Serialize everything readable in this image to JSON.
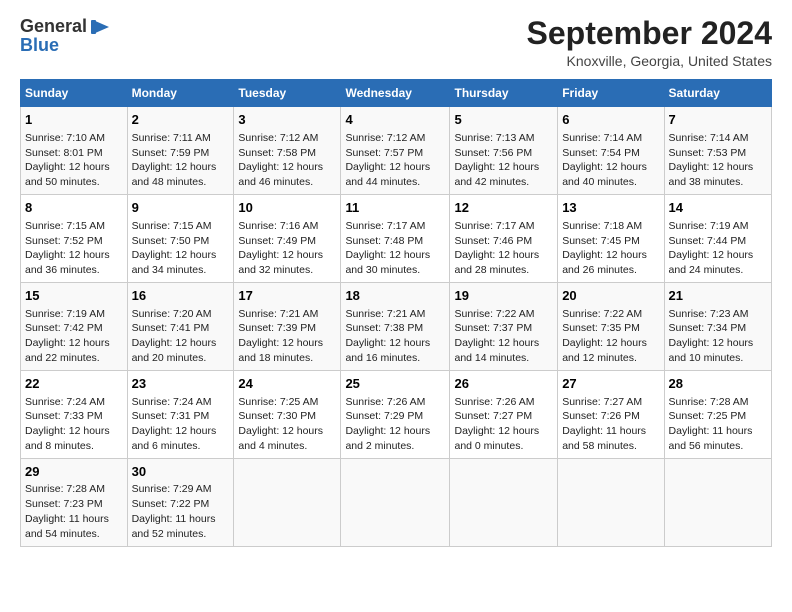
{
  "logo": {
    "general": "General",
    "blue": "Blue",
    "arrow": "▶"
  },
  "title": "September 2024",
  "subtitle": "Knoxville, Georgia, United States",
  "columns": [
    "Sunday",
    "Monday",
    "Tuesday",
    "Wednesday",
    "Thursday",
    "Friday",
    "Saturday"
  ],
  "weeks": [
    [
      {
        "day": "1",
        "lines": [
          "Sunrise: 7:10 AM",
          "Sunset: 8:01 PM",
          "Daylight: 12 hours",
          "and 50 minutes."
        ]
      },
      {
        "day": "2",
        "lines": [
          "Sunrise: 7:11 AM",
          "Sunset: 7:59 PM",
          "Daylight: 12 hours",
          "and 48 minutes."
        ]
      },
      {
        "day": "3",
        "lines": [
          "Sunrise: 7:12 AM",
          "Sunset: 7:58 PM",
          "Daylight: 12 hours",
          "and 46 minutes."
        ]
      },
      {
        "day": "4",
        "lines": [
          "Sunrise: 7:12 AM",
          "Sunset: 7:57 PM",
          "Daylight: 12 hours",
          "and 44 minutes."
        ]
      },
      {
        "day": "5",
        "lines": [
          "Sunrise: 7:13 AM",
          "Sunset: 7:56 PM",
          "Daylight: 12 hours",
          "and 42 minutes."
        ]
      },
      {
        "day": "6",
        "lines": [
          "Sunrise: 7:14 AM",
          "Sunset: 7:54 PM",
          "Daylight: 12 hours",
          "and 40 minutes."
        ]
      },
      {
        "day": "7",
        "lines": [
          "Sunrise: 7:14 AM",
          "Sunset: 7:53 PM",
          "Daylight: 12 hours",
          "and 38 minutes."
        ]
      }
    ],
    [
      {
        "day": "8",
        "lines": [
          "Sunrise: 7:15 AM",
          "Sunset: 7:52 PM",
          "Daylight: 12 hours",
          "and 36 minutes."
        ]
      },
      {
        "day": "9",
        "lines": [
          "Sunrise: 7:15 AM",
          "Sunset: 7:50 PM",
          "Daylight: 12 hours",
          "and 34 minutes."
        ]
      },
      {
        "day": "10",
        "lines": [
          "Sunrise: 7:16 AM",
          "Sunset: 7:49 PM",
          "Daylight: 12 hours",
          "and 32 minutes."
        ]
      },
      {
        "day": "11",
        "lines": [
          "Sunrise: 7:17 AM",
          "Sunset: 7:48 PM",
          "Daylight: 12 hours",
          "and 30 minutes."
        ]
      },
      {
        "day": "12",
        "lines": [
          "Sunrise: 7:17 AM",
          "Sunset: 7:46 PM",
          "Daylight: 12 hours",
          "and 28 minutes."
        ]
      },
      {
        "day": "13",
        "lines": [
          "Sunrise: 7:18 AM",
          "Sunset: 7:45 PM",
          "Daylight: 12 hours",
          "and 26 minutes."
        ]
      },
      {
        "day": "14",
        "lines": [
          "Sunrise: 7:19 AM",
          "Sunset: 7:44 PM",
          "Daylight: 12 hours",
          "and 24 minutes."
        ]
      }
    ],
    [
      {
        "day": "15",
        "lines": [
          "Sunrise: 7:19 AM",
          "Sunset: 7:42 PM",
          "Daylight: 12 hours",
          "and 22 minutes."
        ]
      },
      {
        "day": "16",
        "lines": [
          "Sunrise: 7:20 AM",
          "Sunset: 7:41 PM",
          "Daylight: 12 hours",
          "and 20 minutes."
        ]
      },
      {
        "day": "17",
        "lines": [
          "Sunrise: 7:21 AM",
          "Sunset: 7:39 PM",
          "Daylight: 12 hours",
          "and 18 minutes."
        ]
      },
      {
        "day": "18",
        "lines": [
          "Sunrise: 7:21 AM",
          "Sunset: 7:38 PM",
          "Daylight: 12 hours",
          "and 16 minutes."
        ]
      },
      {
        "day": "19",
        "lines": [
          "Sunrise: 7:22 AM",
          "Sunset: 7:37 PM",
          "Daylight: 12 hours",
          "and 14 minutes."
        ]
      },
      {
        "day": "20",
        "lines": [
          "Sunrise: 7:22 AM",
          "Sunset: 7:35 PM",
          "Daylight: 12 hours",
          "and 12 minutes."
        ]
      },
      {
        "day": "21",
        "lines": [
          "Sunrise: 7:23 AM",
          "Sunset: 7:34 PM",
          "Daylight: 12 hours",
          "and 10 minutes."
        ]
      }
    ],
    [
      {
        "day": "22",
        "lines": [
          "Sunrise: 7:24 AM",
          "Sunset: 7:33 PM",
          "Daylight: 12 hours",
          "and 8 minutes."
        ]
      },
      {
        "day": "23",
        "lines": [
          "Sunrise: 7:24 AM",
          "Sunset: 7:31 PM",
          "Daylight: 12 hours",
          "and 6 minutes."
        ]
      },
      {
        "day": "24",
        "lines": [
          "Sunrise: 7:25 AM",
          "Sunset: 7:30 PM",
          "Daylight: 12 hours",
          "and 4 minutes."
        ]
      },
      {
        "day": "25",
        "lines": [
          "Sunrise: 7:26 AM",
          "Sunset: 7:29 PM",
          "Daylight: 12 hours",
          "and 2 minutes."
        ]
      },
      {
        "day": "26",
        "lines": [
          "Sunrise: 7:26 AM",
          "Sunset: 7:27 PM",
          "Daylight: 12 hours",
          "and 0 minutes."
        ]
      },
      {
        "day": "27",
        "lines": [
          "Sunrise: 7:27 AM",
          "Sunset: 7:26 PM",
          "Daylight: 11 hours",
          "and 58 minutes."
        ]
      },
      {
        "day": "28",
        "lines": [
          "Sunrise: 7:28 AM",
          "Sunset: 7:25 PM",
          "Daylight: 11 hours",
          "and 56 minutes."
        ]
      }
    ],
    [
      {
        "day": "29",
        "lines": [
          "Sunrise: 7:28 AM",
          "Sunset: 7:23 PM",
          "Daylight: 11 hours",
          "and 54 minutes."
        ]
      },
      {
        "day": "30",
        "lines": [
          "Sunrise: 7:29 AM",
          "Sunset: 7:22 PM",
          "Daylight: 11 hours",
          "and 52 minutes."
        ]
      },
      null,
      null,
      null,
      null,
      null
    ]
  ]
}
